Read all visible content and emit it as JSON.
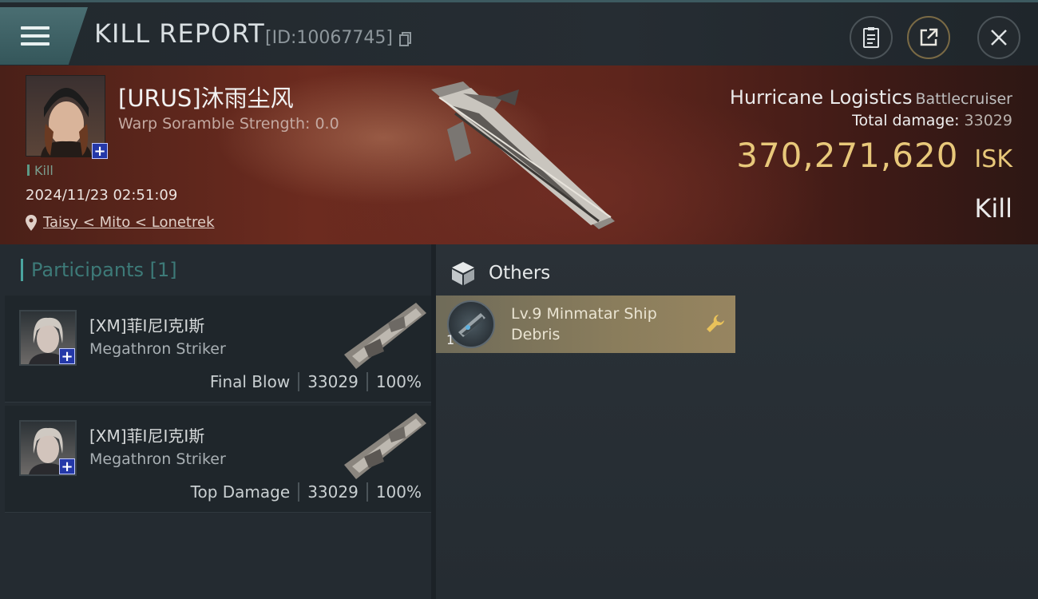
{
  "header": {
    "title": "KILL REPORT",
    "id_text": "[ID:10067745]"
  },
  "victim": {
    "name": "[URUS]沐雨尘风",
    "scramble": "Warp Soramble Strength: 0.0",
    "kill_tag": "Kill",
    "datetime": "2024/11/23 02:51:09",
    "location": "Taisy < Mito < Lonetrek",
    "ship_name": "Hurricane Logistics",
    "ship_class": "Battlecruiser",
    "total_damage_label": "Total damage:",
    "total_damage": "33029",
    "isk_value": "370,271,620",
    "isk_unit": "ISK",
    "result": "Kill"
  },
  "participants": {
    "title": "Participants [1]",
    "rows": [
      {
        "name": "[XM]菲I尼I克I斯",
        "ship": "Megathron Striker",
        "role": "Final Blow",
        "damage": "33029",
        "percent": "100%"
      },
      {
        "name": "[XM]菲I尼I克I斯",
        "ship": "Megathron Striker",
        "role": "Top Damage",
        "damage": "33029",
        "percent": "100%"
      }
    ]
  },
  "others": {
    "title": "Others",
    "items": [
      {
        "qty": "1",
        "name": "Lv.9 Minmatar Ship Debris"
      }
    ]
  },
  "colors": {
    "accent_teal": "#4aa5a0",
    "isk_gold": "#e8c87a",
    "item_card": "#8a7d5c"
  },
  "icons": [
    "menu-icon",
    "copy-icon",
    "clipboard-icon",
    "share-icon",
    "close-icon",
    "location-pin-icon",
    "box-icon",
    "wrench-icon"
  ]
}
